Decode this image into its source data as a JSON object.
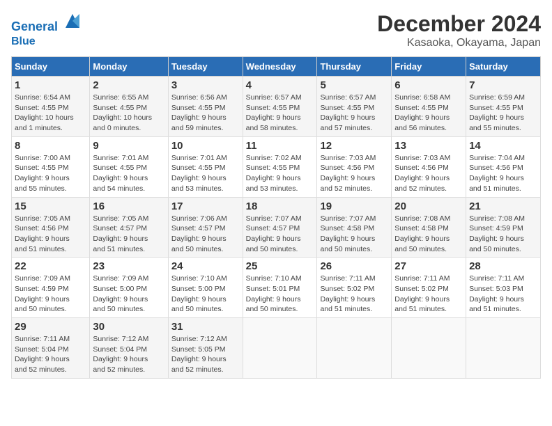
{
  "logo": {
    "line1": "General",
    "line2": "Blue"
  },
  "title": "December 2024",
  "subtitle": "Kasaoka, Okayama, Japan",
  "days_of_week": [
    "Sunday",
    "Monday",
    "Tuesday",
    "Wednesday",
    "Thursday",
    "Friday",
    "Saturday"
  ],
  "weeks": [
    [
      {
        "day": "1",
        "sunrise": "6:54 AM",
        "sunset": "4:55 PM",
        "daylight_h": "10",
        "daylight_m": "1"
      },
      {
        "day": "2",
        "sunrise": "6:55 AM",
        "sunset": "4:55 PM",
        "daylight_h": "10",
        "daylight_m": "0"
      },
      {
        "day": "3",
        "sunrise": "6:56 AM",
        "sunset": "4:55 PM",
        "daylight_h": "9",
        "daylight_m": "59"
      },
      {
        "day": "4",
        "sunrise": "6:57 AM",
        "sunset": "4:55 PM",
        "daylight_h": "9",
        "daylight_m": "58"
      },
      {
        "day": "5",
        "sunrise": "6:57 AM",
        "sunset": "4:55 PM",
        "daylight_h": "9",
        "daylight_m": "57"
      },
      {
        "day": "6",
        "sunrise": "6:58 AM",
        "sunset": "4:55 PM",
        "daylight_h": "9",
        "daylight_m": "56"
      },
      {
        "day": "7",
        "sunrise": "6:59 AM",
        "sunset": "4:55 PM",
        "daylight_h": "9",
        "daylight_m": "55"
      }
    ],
    [
      {
        "day": "8",
        "sunrise": "7:00 AM",
        "sunset": "4:55 PM",
        "daylight_h": "9",
        "daylight_m": "55"
      },
      {
        "day": "9",
        "sunrise": "7:01 AM",
        "sunset": "4:55 PM",
        "daylight_h": "9",
        "daylight_m": "54"
      },
      {
        "day": "10",
        "sunrise": "7:01 AM",
        "sunset": "4:55 PM",
        "daylight_h": "9",
        "daylight_m": "53"
      },
      {
        "day": "11",
        "sunrise": "7:02 AM",
        "sunset": "4:55 PM",
        "daylight_h": "9",
        "daylight_m": "53"
      },
      {
        "day": "12",
        "sunrise": "7:03 AM",
        "sunset": "4:56 PM",
        "daylight_h": "9",
        "daylight_m": "52"
      },
      {
        "day": "13",
        "sunrise": "7:03 AM",
        "sunset": "4:56 PM",
        "daylight_h": "9",
        "daylight_m": "52"
      },
      {
        "day": "14",
        "sunrise": "7:04 AM",
        "sunset": "4:56 PM",
        "daylight_h": "9",
        "daylight_m": "51"
      }
    ],
    [
      {
        "day": "15",
        "sunrise": "7:05 AM",
        "sunset": "4:56 PM",
        "daylight_h": "9",
        "daylight_m": "51"
      },
      {
        "day": "16",
        "sunrise": "7:05 AM",
        "sunset": "4:57 PM",
        "daylight_h": "9",
        "daylight_m": "51"
      },
      {
        "day": "17",
        "sunrise": "7:06 AM",
        "sunset": "4:57 PM",
        "daylight_h": "9",
        "daylight_m": "50"
      },
      {
        "day": "18",
        "sunrise": "7:07 AM",
        "sunset": "4:57 PM",
        "daylight_h": "9",
        "daylight_m": "50"
      },
      {
        "day": "19",
        "sunrise": "7:07 AM",
        "sunset": "4:58 PM",
        "daylight_h": "9",
        "daylight_m": "50"
      },
      {
        "day": "20",
        "sunrise": "7:08 AM",
        "sunset": "4:58 PM",
        "daylight_h": "9",
        "daylight_m": "50"
      },
      {
        "day": "21",
        "sunrise": "7:08 AM",
        "sunset": "4:59 PM",
        "daylight_h": "9",
        "daylight_m": "50"
      }
    ],
    [
      {
        "day": "22",
        "sunrise": "7:09 AM",
        "sunset": "4:59 PM",
        "daylight_h": "9",
        "daylight_m": "50"
      },
      {
        "day": "23",
        "sunrise": "7:09 AM",
        "sunset": "5:00 PM",
        "daylight_h": "9",
        "daylight_m": "50"
      },
      {
        "day": "24",
        "sunrise": "7:10 AM",
        "sunset": "5:00 PM",
        "daylight_h": "9",
        "daylight_m": "50"
      },
      {
        "day": "25",
        "sunrise": "7:10 AM",
        "sunset": "5:01 PM",
        "daylight_h": "9",
        "daylight_m": "50"
      },
      {
        "day": "26",
        "sunrise": "7:11 AM",
        "sunset": "5:02 PM",
        "daylight_h": "9",
        "daylight_m": "51"
      },
      {
        "day": "27",
        "sunrise": "7:11 AM",
        "sunset": "5:02 PM",
        "daylight_h": "9",
        "daylight_m": "51"
      },
      {
        "day": "28",
        "sunrise": "7:11 AM",
        "sunset": "5:03 PM",
        "daylight_h": "9",
        "daylight_m": "51"
      }
    ],
    [
      {
        "day": "29",
        "sunrise": "7:11 AM",
        "sunset": "5:04 PM",
        "daylight_h": "9",
        "daylight_m": "52"
      },
      {
        "day": "30",
        "sunrise": "7:12 AM",
        "sunset": "5:04 PM",
        "daylight_h": "9",
        "daylight_m": "52"
      },
      {
        "day": "31",
        "sunrise": "7:12 AM",
        "sunset": "5:05 PM",
        "daylight_h": "9",
        "daylight_m": "52"
      },
      null,
      null,
      null,
      null
    ]
  ]
}
